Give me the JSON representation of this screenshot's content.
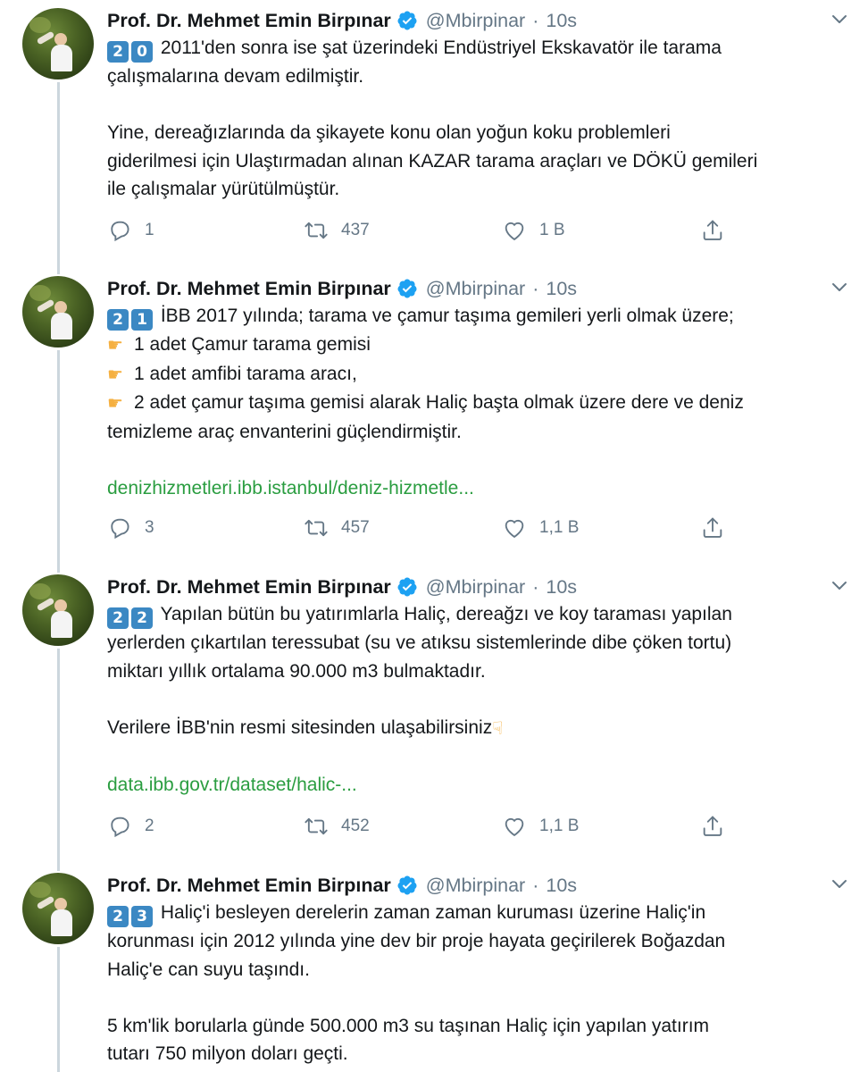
{
  "tweets": [
    {
      "author": {
        "name": "Prof. Dr. Mehmet Emin Birpınar",
        "handle": "@Mbirpinar"
      },
      "separator": "·",
      "time": "10s",
      "number_keycaps": [
        "2",
        "0"
      ],
      "paragraphs": [
        {
          "lines": [
            "2011'den sonra ise şat üzerindeki Endüstriyel Ekskavatör ile tarama",
            "çalışmalarına devam edilmiştir."
          ]
        },
        {
          "lines": [
            "Yine, dereağızlarında da şikayete konu olan yoğun koku problemleri",
            "giderilmesi için Ulaştırmadan alınan KAZAR tarama araçları ve DÖKÜ gemileri",
            "ile çalışmalar yürütülmüştür."
          ]
        }
      ],
      "stats": {
        "replies": "1",
        "retweets": "437",
        "likes": "1 B"
      }
    },
    {
      "author": {
        "name": "Prof. Dr. Mehmet Emin Birpınar",
        "handle": "@Mbirpinar"
      },
      "separator": "·",
      "time": "10s",
      "number_keycaps": [
        "2",
        "1"
      ],
      "lines": [
        "İBB 2017 yılında; tarama ve çamur taşıma gemileri yerli olmak üzere;",
        "1 adet Çamur tarama gemisi",
        "1 adet amfibi tarama aracı,",
        "2 adet çamur taşıma gemisi alarak Haliç başta olmak üzere dere ve deniz",
        "temizleme araç envanterini güçlendirmiştir."
      ],
      "bullet_icon": "pointing-right-hand-emoji",
      "link": "denizhizmetleri.ibb.istanbul/deniz-hizmetle...",
      "stats": {
        "replies": "3",
        "retweets": "457",
        "likes": "1,1 B"
      }
    },
    {
      "author": {
        "name": "Prof. Dr. Mehmet Emin Birpınar",
        "handle": "@Mbirpinar"
      },
      "separator": "·",
      "time": "10s",
      "number_keycaps": [
        "2",
        "2"
      ],
      "paragraphs": [
        {
          "lines": [
            "Yapılan bütün bu yatırımlarla Haliç, dereağzı ve koy taraması yapılan",
            "yerlerden çıkartılan teressubat (su ve atıksu sistemlerinde dibe çöken tortu)",
            "miktarı yıllık ortalama 90.000 m3 bulmaktadır."
          ]
        },
        {
          "lines": [
            "Verilere İBB'nin resmi sitesinden ulaşabilirsiniz"
          ]
        }
      ],
      "trailing_icon": "pointing-down-hand-emoji",
      "link": "data.ibb.gov.tr/dataset/halic-...",
      "stats": {
        "replies": "2",
        "retweets": "452",
        "likes": "1,1 B"
      }
    },
    {
      "author": {
        "name": "Prof. Dr. Mehmet Emin Birpınar",
        "handle": "@Mbirpinar"
      },
      "separator": "·",
      "time": "10s",
      "number_keycaps": [
        "2",
        "3"
      ],
      "paragraphs": [
        {
          "lines": [
            "Haliç'i besleyen derelerin zaman zaman kuruması üzerine Haliç'in",
            "korunması için 2012 yılında yine dev bir proje hayata geçirilerek Boğazdan",
            "Haliç'e can suyu taşındı."
          ]
        },
        {
          "lines": [
            "5 km'lik borularla günde 500.000 m3 su taşınan Haliç için yapılan yatırım",
            "tutarı 750 milyon doları geçti."
          ]
        }
      ]
    }
  ],
  "colors": {
    "text": "#14171a",
    "secondary": "#657786",
    "link": "#2a9d40",
    "verified": "#1da1f2",
    "keycap": "#3b88c3",
    "thread_line": "#ccd6dd"
  }
}
